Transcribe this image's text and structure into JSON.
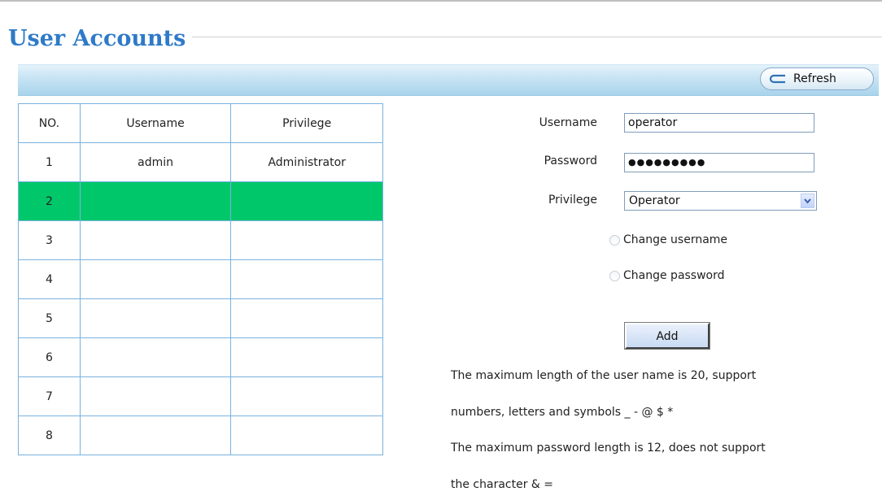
{
  "title": "User Accounts",
  "toolbar": {
    "refresh_label": "Refresh"
  },
  "table": {
    "headers": [
      "NO.",
      "Username",
      "Privilege"
    ],
    "rows": [
      {
        "no": "1",
        "username": "admin",
        "privilege": "Administrator"
      },
      {
        "no": "2",
        "username": "",
        "privilege": ""
      },
      {
        "no": "3",
        "username": "",
        "privilege": ""
      },
      {
        "no": "4",
        "username": "",
        "privilege": ""
      },
      {
        "no": "5",
        "username": "",
        "privilege": ""
      },
      {
        "no": "6",
        "username": "",
        "privilege": ""
      },
      {
        "no": "7",
        "username": "",
        "privilege": ""
      },
      {
        "no": "8",
        "username": "",
        "privilege": ""
      }
    ],
    "selected_row": "2",
    "selected_color": "#00c86a"
  },
  "form": {
    "username_label": "Username",
    "username_value": "operator",
    "password_label": "Password",
    "password_masked": "●●●●●●●●●",
    "privilege_label": "Privilege",
    "privilege_value": "Operator",
    "change_username_label": "Change username",
    "change_password_label": "Change password",
    "add_label": "Add"
  },
  "notes": [
    "The maximum length of the user name is 20, support",
    "numbers, letters and symbols _ - @ $ *",
    "The maximum password length is 12, does not support",
    "the character & ="
  ],
  "colors": {
    "title": "#2e7ac8",
    "table_border": "#79b2de",
    "toolbar": "#c6e3f3"
  }
}
